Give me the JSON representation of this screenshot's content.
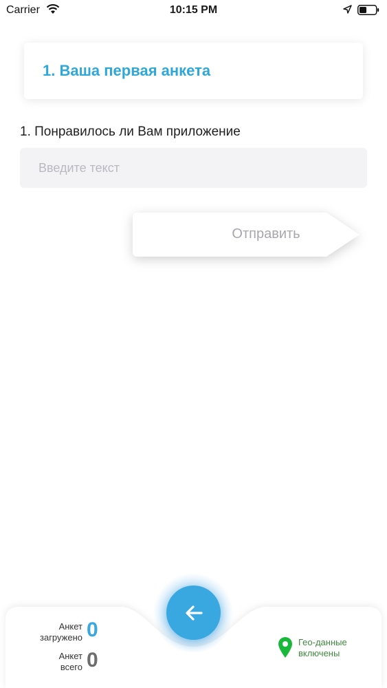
{
  "status_bar": {
    "carrier": "Carrier",
    "time": "10:15 PM",
    "wifi_icon": "wifi-icon",
    "location_icon": "location-arrow-icon",
    "battery_icon": "battery-icon"
  },
  "survey": {
    "title": "1. Ваша первая анкета",
    "question": "1. Понравилось ли Вам приложение",
    "input_value": "",
    "input_placeholder": "Введите текст",
    "submit_label": "Отправить"
  },
  "footer": {
    "uploaded_label_line1": "Анкет",
    "uploaded_label_line2": "загружено",
    "uploaded_count": "0",
    "total_label_line1": "Анкет",
    "total_label_line2": "всего",
    "total_count": "0",
    "geo_line1": "Гео-данные",
    "geo_line2": "включены",
    "back_icon": "arrow-left-icon",
    "geo_icon": "map-pin-icon"
  },
  "colors": {
    "accent": "#2fa7d9",
    "back_button": "#3aa8e0",
    "uploaded_count": "#3aa8e0",
    "total_count": "#6e6e6e",
    "geo_green": "#19b83a",
    "geo_text": "#3f8a3f"
  }
}
